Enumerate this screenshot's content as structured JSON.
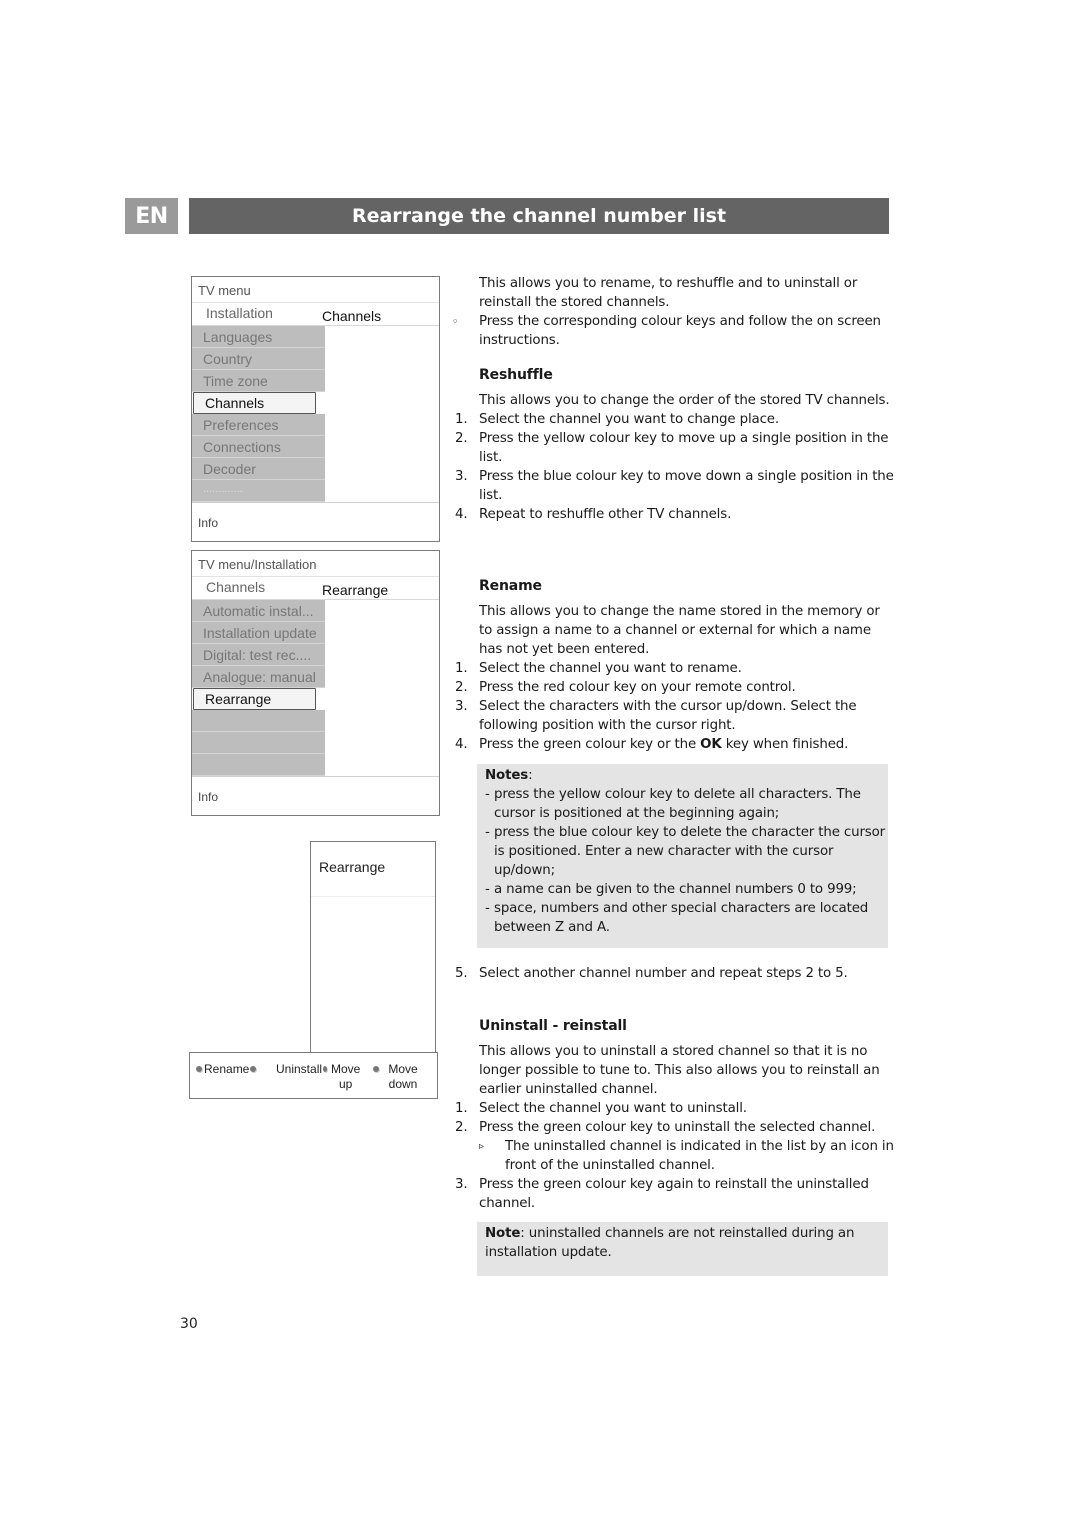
{
  "header": {
    "lang_badge": "EN",
    "title": "Rearrange the channel number list"
  },
  "menu1": {
    "header": "TV menu",
    "sub_left": "Installation",
    "sub_right": "Channels",
    "items": [
      "Languages",
      "Country",
      "Time zone",
      "Channels",
      "Preferences",
      "Connections",
      "Decoder",
      "............."
    ],
    "selected_index": 3,
    "info": "Info"
  },
  "menu2": {
    "header": "TV menu/Installation",
    "sub_left": "Channels",
    "sub_right": "Rearrange",
    "items": [
      "Automatic instal...",
      "Installation update",
      "Digital: test rec....",
      "Analogue: manual",
      "Rearrange",
      "",
      "",
      ""
    ],
    "selected_index": 4,
    "info": "Info"
  },
  "rearrange_panel": {
    "title": "Rearrange",
    "keys": [
      {
        "label": "Rename",
        "color": "red"
      },
      {
        "label": "Uninstall",
        "color": "green"
      },
      {
        "label": "Move up",
        "line1": "Move",
        "line2": "up",
        "color": "yellow"
      },
      {
        "label": "Move down",
        "line1": "Move",
        "line2": "down",
        "color": "blue"
      }
    ]
  },
  "intro": {
    "text": "This allows you to rename, to reshuffle and to uninstall or reinstall the stored channels.",
    "bullet_symbol": "◦",
    "bullet": "Press the corresponding colour keys and follow the on screen instructions."
  },
  "reshuffle": {
    "heading": "Reshuffle",
    "text": "This allows you to change the order of the stored TV channels.",
    "steps": [
      "Select the channel you want to change place.",
      "Press the yellow colour key  to move up a single position in the list.",
      "Press the blue colour key to move down a single position in the list.",
      "Repeat to reshuffle other TV channels."
    ]
  },
  "rename": {
    "heading": "Rename",
    "text": "This allows you to change the name stored in the memory or to assign a name to a channel or external for which a name has not yet been entered.",
    "steps": [
      "Select the channel you want to rename.",
      "Press the red colour key on your remote control.",
      "Select the characters with the cursor up/down. Select the following position with the cursor right."
    ],
    "step4_pre": "Press the green colour key or the ",
    "step4_bold": "OK",
    "step4_post": " key when finished.",
    "notes_label": "Notes",
    "notes": [
      "press the yellow colour key to delete all characters. The cursor is positioned at the beginning again;",
      "press the blue colour key to delete the character the cursor is positioned. Enter a new character with the cursor up/down;",
      "a name can be given to the channel numbers 0 to 999;",
      "space, numbers and other special characters are located between Z and A."
    ],
    "step5": "Select another channel number and repeat steps 2 to 5."
  },
  "uninstall": {
    "heading": "Uninstall - reinstall",
    "text": "This allows you to uninstall a stored channel so that it is no longer possible to tune to. This also allows you to reinstall an earlier uninstalled channel.",
    "steps": [
      "Select the channel you want to uninstall.",
      "Press the green colour key to uninstall the selected channel.",
      "Press the green colour key again to reinstall the uninstalled channel."
    ],
    "result_symbol": "▹",
    "result": "The uninstalled channel is indicated in the list by an icon in front of the uninstalled channel.",
    "note_label": "Note",
    "note_text": ": uninstalled channels are not reinstalled during an installation update."
  },
  "page_number": "30"
}
